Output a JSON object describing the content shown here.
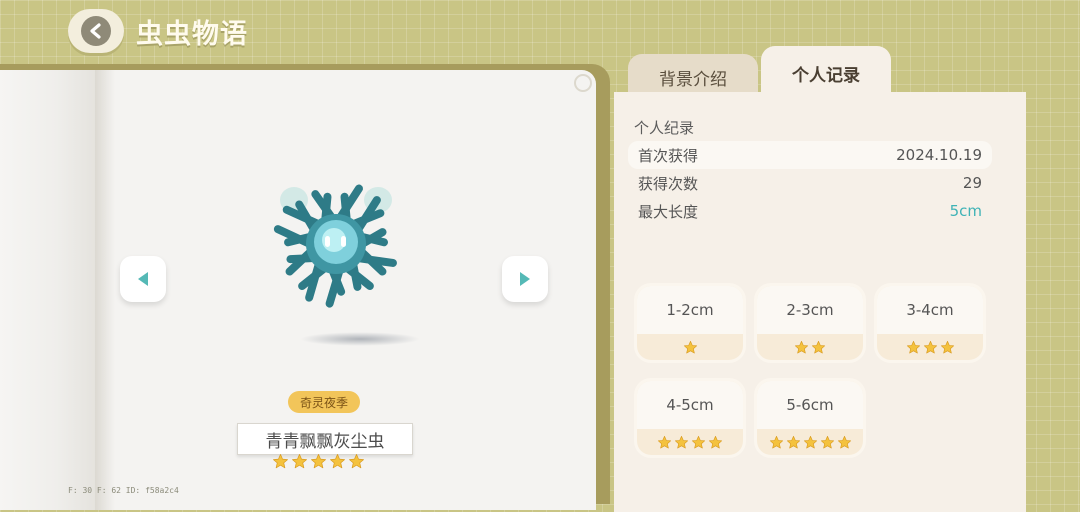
{
  "header": {
    "title": "虫虫物语",
    "back_icon": "chevron-left-icon"
  },
  "tabs": [
    {
      "label": "背景介绍",
      "active": false
    },
    {
      "label": "个人记录",
      "active": true
    }
  ],
  "creature": {
    "name": "青青飘飘灰尘虫",
    "season_badge": "奇灵夜季",
    "rarity_stars": 5,
    "icon": "fuzzy-teal-bug-icon"
  },
  "records": {
    "title": "个人纪录",
    "rows": [
      {
        "label": "首次获得",
        "value": "2024.10.19"
      },
      {
        "label": "获得次数",
        "value": "29"
      },
      {
        "label": "最大长度",
        "value": "5cm"
      }
    ]
  },
  "size_tiers": [
    {
      "label": "1-2cm",
      "stars": 1
    },
    {
      "label": "2-3cm",
      "stars": 2
    },
    {
      "label": "3-4cm",
      "stars": 3
    },
    {
      "label": "4-5cm",
      "stars": 4
    },
    {
      "label": "5-6cm",
      "stars": 5
    }
  ],
  "debug_text": "F: 30   F: 62   ID: f58a2c4",
  "colors": {
    "accent_teal": "#3fb3b6",
    "star_gold": "#f4c23e",
    "background": "#c9c585"
  }
}
